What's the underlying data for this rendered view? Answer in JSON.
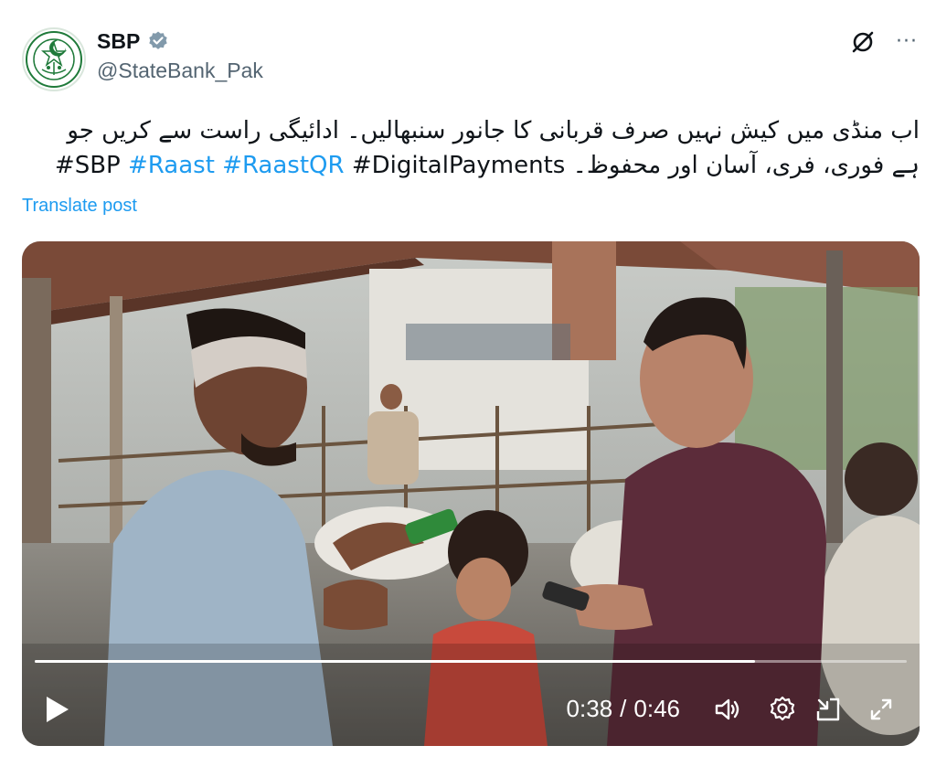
{
  "author": {
    "display_name": "SBP",
    "handle": "@StateBank_Pak",
    "avatar_icon": "sbp-logo",
    "verified_icon": "verified-badge-icon"
  },
  "actions": {
    "grok_icon": "grok-icon",
    "more_label": "···"
  },
  "post": {
    "line1": "اب منڈی میں کیش نہیں صرف قربانی کا جانور سنبھالیں۔ ادائیگی راست سے کریں جو",
    "line2_urdu": "ہے فوری، فری، آسان اور محفوظ۔",
    "hashtags": [
      "#SBP",
      "#Raast",
      "#RaastQR",
      "#DigitalPayments"
    ],
    "translate_label": "Translate post"
  },
  "video": {
    "current_time": "0:38",
    "separator": "/",
    "duration": "0:46",
    "progress_fraction": 0.826,
    "icons": [
      "play-icon",
      "volume-icon",
      "settings-icon",
      "picture-in-picture-icon",
      "fullscreen-icon"
    ]
  },
  "colors": {
    "link": "#1d9bf0",
    "text": "#0f1419",
    "secondary": "#536471",
    "verified": "#829aab"
  }
}
